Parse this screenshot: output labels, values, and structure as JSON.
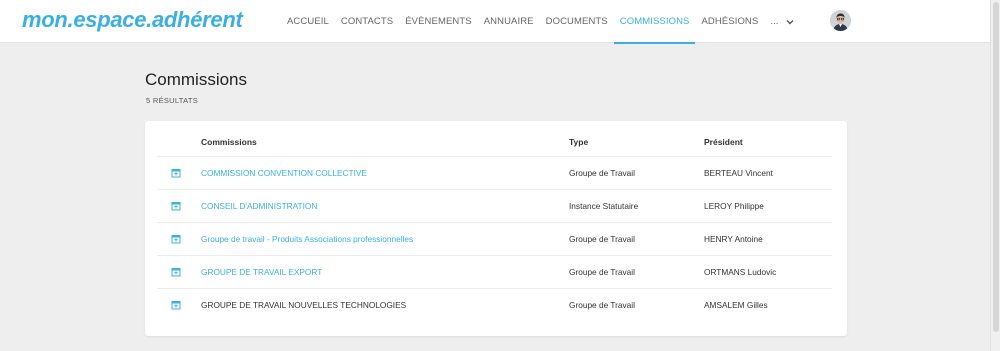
{
  "header": {
    "logo": "mon.espace.adhérent",
    "nav": [
      {
        "label": "ACCUEIL",
        "active": false
      },
      {
        "label": "CONTACTS",
        "active": false
      },
      {
        "label": "ÉVÈNEMENTS",
        "active": false
      },
      {
        "label": "ANNUAIRE",
        "active": false
      },
      {
        "label": "DOCUMENTS",
        "active": false
      },
      {
        "label": "COMMISSIONS",
        "active": true
      },
      {
        "label": "ADHÉSIONS",
        "active": false
      }
    ],
    "more_label": "...",
    "accent_color": "#3ab0e2"
  },
  "main": {
    "title": "Commissions",
    "results": "5 RÉSULTATS",
    "table": {
      "headers": {
        "name": "Commissions",
        "type": "Type",
        "president": "Président"
      },
      "rows": [
        {
          "name": "COMMISSION CONVENTION COLLECTIVE",
          "type": "Groupe de Travail",
          "president": "BERTEAU Vincent",
          "icon": "calendar-icon",
          "link": true
        },
        {
          "name": "CONSEIL D'ADMINISTRATION",
          "type": "Instance Statutaire",
          "president": "LEROY Philippe",
          "icon": "calendar-icon",
          "link": true
        },
        {
          "name": "Groupe de travail - Produits Associations professionnelles",
          "type": "Groupe de Travail",
          "president": "HENRY Antoine",
          "icon": "calendar-icon",
          "link": true
        },
        {
          "name": "GROUPE DE TRAVAIL EXPORT",
          "type": "Groupe de Travail",
          "president": "ORTMANS Ludovic",
          "icon": "calendar-icon",
          "link": true
        },
        {
          "name": "GROUPE DE TRAVAIL NOUVELLES TECHNOLOGIES",
          "type": "Groupe de Travail",
          "president": "AMSALEM Gilles",
          "icon": "calendar-icon",
          "link": false
        }
      ]
    }
  }
}
